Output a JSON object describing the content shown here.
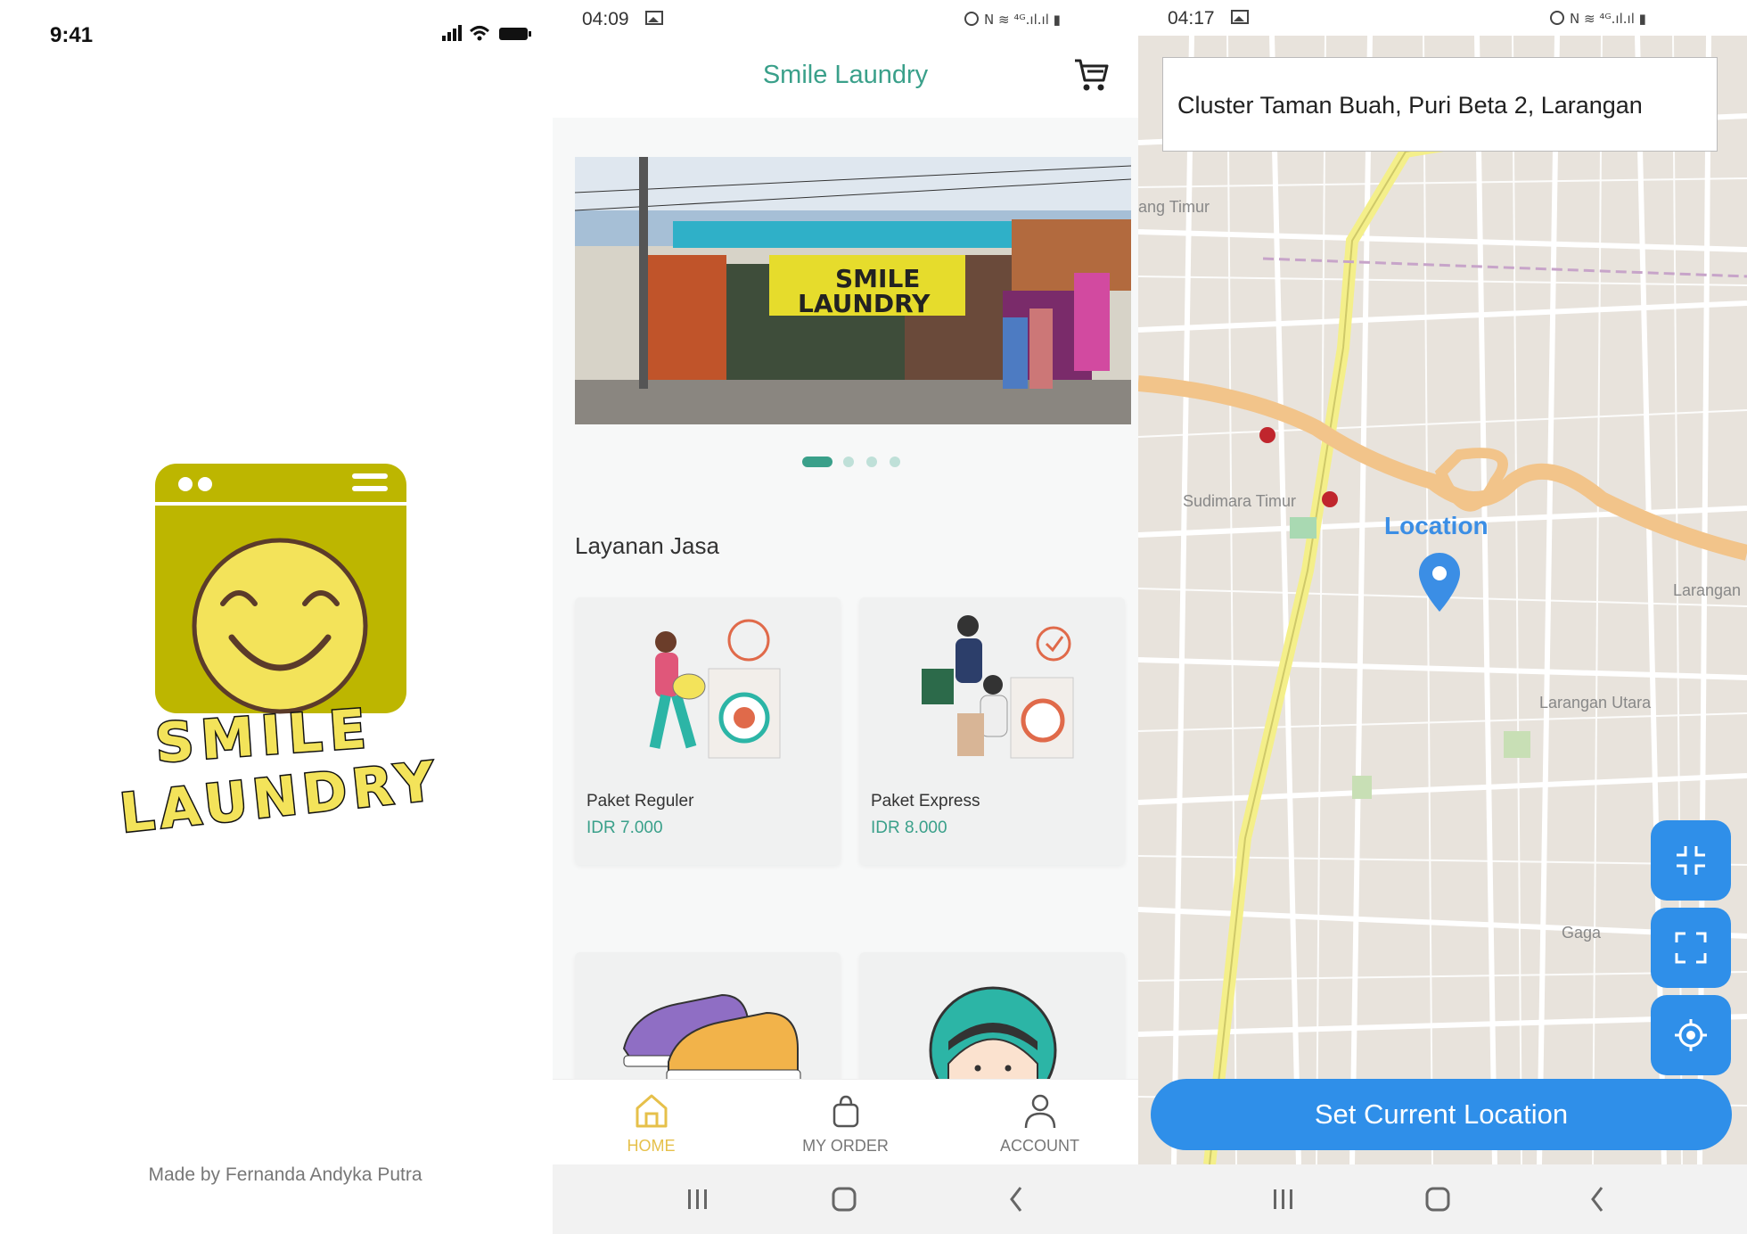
{
  "splash": {
    "time": "9:41",
    "logo_top": "SMILE",
    "logo_bottom": "LAUNDRY",
    "credit": "Made by Fernanda Andyka Putra"
  },
  "home": {
    "time": "04:09",
    "title": "Smile Laundry",
    "banner_sign_line1": "SMILE",
    "banner_sign_line2": "LAUNDRY",
    "section_title": "Layanan Jasa",
    "cards": [
      {
        "name": "Paket Reguler",
        "price": "IDR 7.000"
      },
      {
        "name": "Paket Express",
        "price": "IDR 8.000"
      }
    ],
    "nav": [
      {
        "label": "HOME",
        "icon": "home-icon",
        "active": true
      },
      {
        "label": "MY ORDER",
        "icon": "bag-icon",
        "active": false
      },
      {
        "label": "ACCOUNT",
        "icon": "person-icon",
        "active": false
      }
    ]
  },
  "map_screen": {
    "time": "04:17",
    "address": "Cluster Taman Buah, Puri Beta 2, Larangan",
    "location_label": "Location",
    "set_button": "Set Current Location",
    "map_labels": {
      "sudimara": "Sudimara Timur",
      "larangan": "Larangan",
      "larangan_utara": "Larangan Utara",
      "gaga": "Gaga",
      "timur": "ang Timur"
    }
  },
  "colors": {
    "teal": "#3aa08a",
    "olive": "#bdb600",
    "yellow": "#f3e35a",
    "blue": "#2f8fe9",
    "nav_active": "#e6c04a"
  }
}
